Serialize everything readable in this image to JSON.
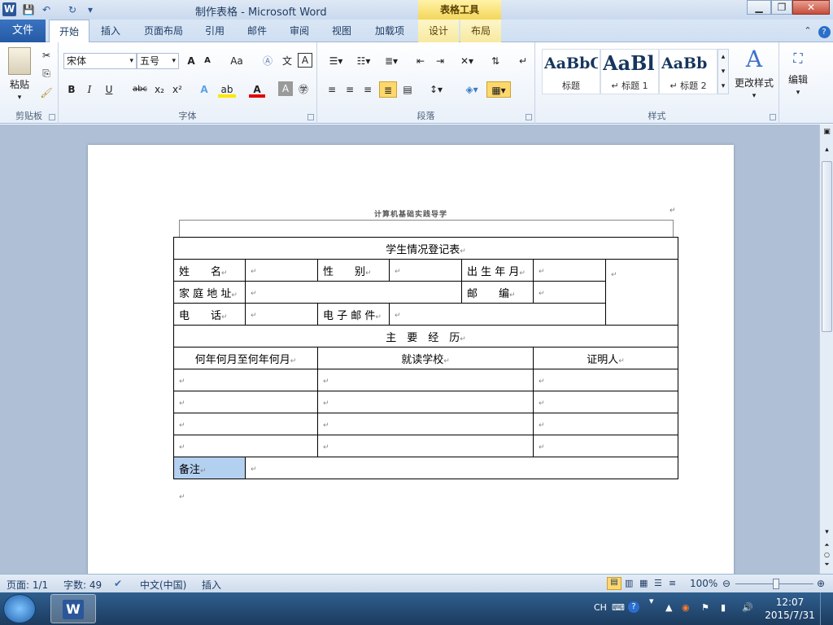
{
  "window": {
    "title": "制作表格 - Microsoft Word",
    "context_tab_title": "表格工具",
    "min": "▁",
    "max": "❐",
    "close": "✕"
  },
  "quick_access": {
    "save": "💾",
    "undo": "↶",
    "redo": "↻",
    "more": "▾"
  },
  "ribbon_tabs": {
    "file": "文件",
    "home": "开始",
    "insert": "插入",
    "layout": "页面布局",
    "references": "引用",
    "mailings": "邮件",
    "review": "审阅",
    "view": "视图",
    "addins": "加载项",
    "design": "设计",
    "table_layout": "布局"
  },
  "clipboard": {
    "paste": "粘贴",
    "label": "剪贴板"
  },
  "font": {
    "name": "宋体",
    "size": "五号",
    "label": "字体",
    "grow": "A",
    "shrink": "A",
    "case": "Aa",
    "bold": "B",
    "italic": "I",
    "underline": "U",
    "strike": "abc",
    "sub": "x₂",
    "sup": "x²"
  },
  "paragraph": {
    "label": "段落"
  },
  "styles": {
    "label": "样式",
    "items": [
      {
        "preview": "AaBbC",
        "name": "标题"
      },
      {
        "preview": "AaBl",
        "name": "↵ 标题 1"
      },
      {
        "preview": "AaBb",
        "name": "↵ 标题 2"
      }
    ],
    "change": "更改样式"
  },
  "editing": {
    "label": "编辑"
  },
  "document": {
    "header_text": "计算机基础实践导学",
    "table": {
      "title": "学生情况登记表",
      "name_label": "姓　　名",
      "gender_label": "性　　别",
      "dob_label": "出 生 年 月",
      "address_label": "家 庭 地 址",
      "zip_label": "邮　　编",
      "phone_label": "电　　话",
      "email_label": "电 子 邮 件",
      "experience_label": "主　要　经　历",
      "col_period": "何年何月至何年何月",
      "col_school": "就读学校",
      "col_witness": "证明人",
      "remark_label": "备注"
    }
  },
  "status": {
    "page": "页面: 1/1",
    "words": "字数: 49",
    "language": "中文(中国)",
    "mode": "插入",
    "zoom": "100%"
  },
  "taskbar": {
    "lang": "CH",
    "time": "12:07",
    "date": "2015/7/31"
  }
}
